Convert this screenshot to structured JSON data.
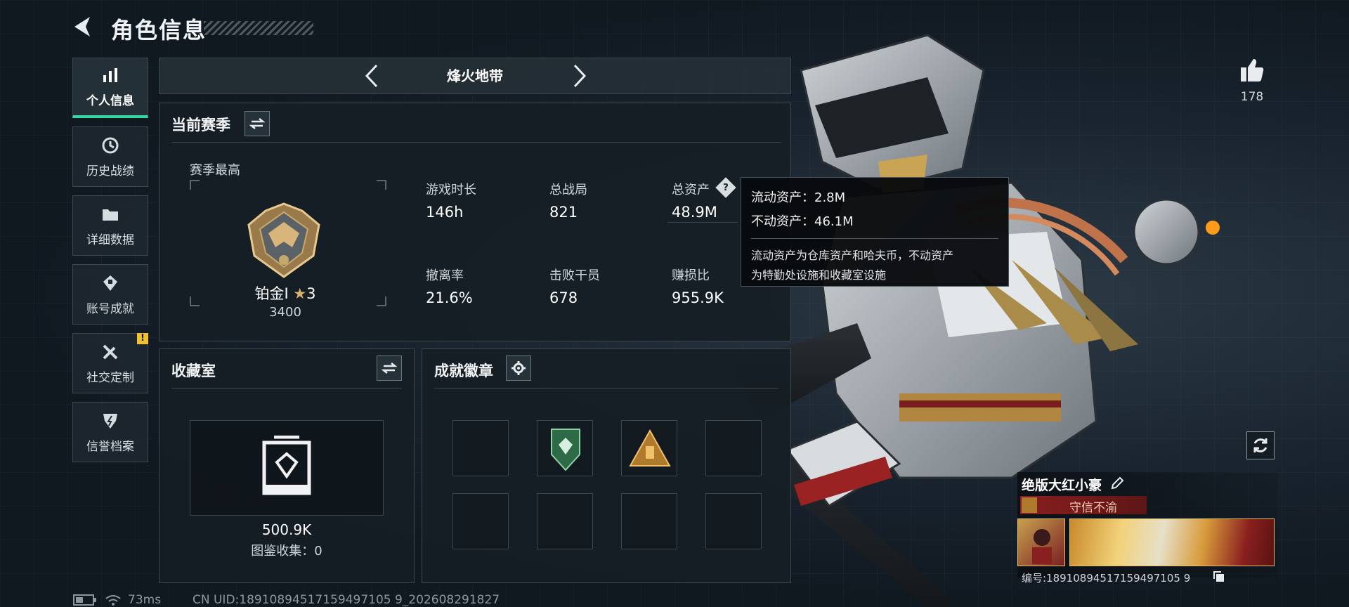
{
  "header": {
    "title": "角色信息"
  },
  "sidebar": {
    "items": [
      {
        "label": "个人信息",
        "active": true,
        "icon": "bar-chart-icon"
      },
      {
        "label": "历史战绩",
        "active": false,
        "icon": "history-icon"
      },
      {
        "label": "详细数据",
        "active": false,
        "icon": "folder-icon"
      },
      {
        "label": "账号成就",
        "active": false,
        "icon": "achievement-icon"
      },
      {
        "label": "社交定制",
        "active": false,
        "icon": "tools-icon",
        "badge": "!"
      },
      {
        "label": "信誉档案",
        "active": false,
        "icon": "credit-shield-icon"
      }
    ]
  },
  "mode": {
    "title": "烽火地带"
  },
  "season": {
    "title": "当前赛季",
    "best_label": "赛季最高",
    "rank": "铂金Ⅰ",
    "stars": "3",
    "rank_score": "3400",
    "stats": [
      {
        "label": "游戏时长",
        "value": "146h"
      },
      {
        "label": "总战局",
        "value": "821"
      },
      {
        "label": "总资产",
        "value": "48.9M"
      },
      {
        "label": "撤离率",
        "value": "21.6%"
      },
      {
        "label": "击败干员",
        "value": "678"
      },
      {
        "label": "赚损比",
        "value": "955.9K"
      }
    ]
  },
  "tooltip": {
    "liquid": "流动资产：2.8M",
    "fixed": "不动资产：46.1M",
    "desc_line1": "流动资产为仓库资产和哈夫币，不动资产",
    "desc_line2": "为特勤处设施和收藏室设施"
  },
  "collection": {
    "title": "收藏室",
    "value": "500.9K",
    "catalog": "图鉴收集：0"
  },
  "achievements": {
    "title": "成就徽章",
    "slots": 8,
    "filled_icons": [
      "green-shield-badge-icon",
      "gold-triangle-badge-icon"
    ]
  },
  "profile": {
    "likes": "178",
    "player_name": "绝版大红小豪",
    "player_title": "守信不渝",
    "player_id": "编号:18910894517159497105 9"
  },
  "status_bar": {
    "ping": "73ms",
    "uid": "CN UID:18910894517159497105 9_202608291827"
  },
  "colors": {
    "accent": "#2fd9a0",
    "warning": "#f2c12e",
    "title_red": "#8a1f1f",
    "tooltip_bg": "#08090b"
  }
}
